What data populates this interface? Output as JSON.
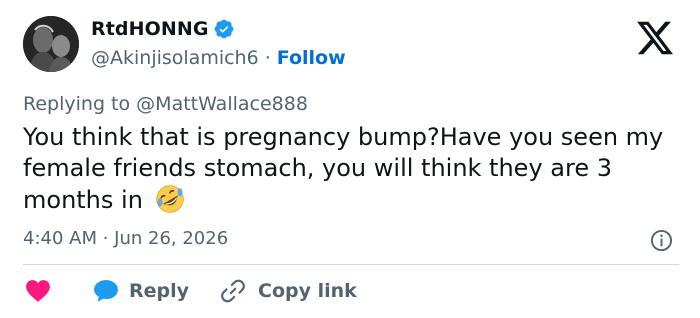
{
  "tweet": {
    "author_name": "RtdHONNG",
    "author_handle": "@Akinjisolamich6",
    "separator": "·",
    "follow_label": "Follow",
    "replying_prefix": "Replying to",
    "replying_to": "@MattWallace888",
    "text": "You think that is pregnancy bump?Have you seen my female friends stomach, you will think they are 3 months in",
    "emoji": "rolling-on-the-floor-laughing",
    "timestamp": "4:40 AM · Jun 26, 2026"
  },
  "actions": {
    "like_icon": "heart-icon",
    "reply_label": "Reply",
    "copy_link_label": "Copy link"
  },
  "colors": {
    "link_blue": "#006fd6",
    "verified_blue": "#1d9bf0",
    "heart_red": "#f91880",
    "secondary_text": "#536471",
    "divider": "#cfd9de"
  }
}
